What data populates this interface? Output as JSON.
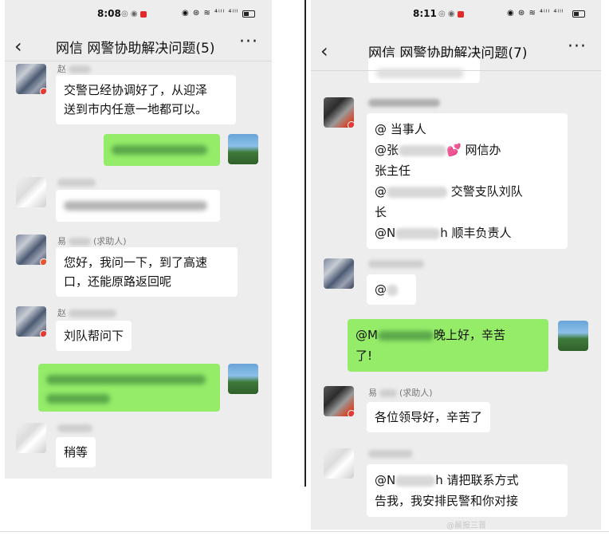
{
  "left": {
    "status": {
      "time": "8:08",
      "icons": "◎ ◉",
      "right_icons": "◉ ⊛ ≋ ⁴ⁱˡˡ ⁴ⁱˡˡ"
    },
    "header": {
      "back": "‹",
      "title": "网信 网警协助解决问题(5)",
      "more": "···"
    },
    "messages": [
      {
        "name": "赵",
        "text_lines": [
          "交警已经协调好了，从迎泽",
          "送到市内任意一地都可以。"
        ]
      },
      {
        "name": "易",
        "role": "(求助人)",
        "text_lines": [
          "您好，我问一下，到了高速",
          "口，还能原路返回呢"
        ]
      },
      {
        "name": "赵",
        "text_lines": [
          "刘队帮问下"
        ]
      },
      {
        "text_lines": [
          "稍等"
        ]
      }
    ]
  },
  "right": {
    "status": {
      "time": "8:11",
      "icons": "◎ ◉",
      "right_icons": "◉ ⊛ ≋ ⁴ⁱˡˡ ⁴ⁱˡˡ"
    },
    "header": {
      "back": "‹",
      "title": "网信 网警协助解决问题(7)",
      "more": "···"
    },
    "mention_block": {
      "line1": "@  当事人",
      "line2_a": "@张",
      "line2_b": "网信办",
      "line3": "张主任",
      "line4_a": "@",
      "line4_b": "交警支队刘队",
      "line5": "长",
      "line6_a": "@N",
      "line6_b": "h 顺丰负责人"
    },
    "mention_short": "@",
    "green_msg": {
      "a": "@M",
      "b": "晚上好，辛苦",
      "c": "了!"
    },
    "helper": {
      "name": "易",
      "role": "(求助人)",
      "text": "各位领导好，辛苦了"
    },
    "last_msg": {
      "a": "@N",
      "b": "h 请把联系方式",
      "c": "告我，我安排民警和你对接"
    }
  },
  "watermark": "@晨报三晋",
  "icons": {
    "heart": "heart-icon",
    "battery": "battery-icon",
    "back": "back-chevron-icon",
    "more": "more-icon"
  },
  "colors": {
    "chat_bg": "#ededed",
    "bubble_green": "#95ec69",
    "bubble_white": "#ffffff",
    "status_red": "#e12b2b"
  }
}
